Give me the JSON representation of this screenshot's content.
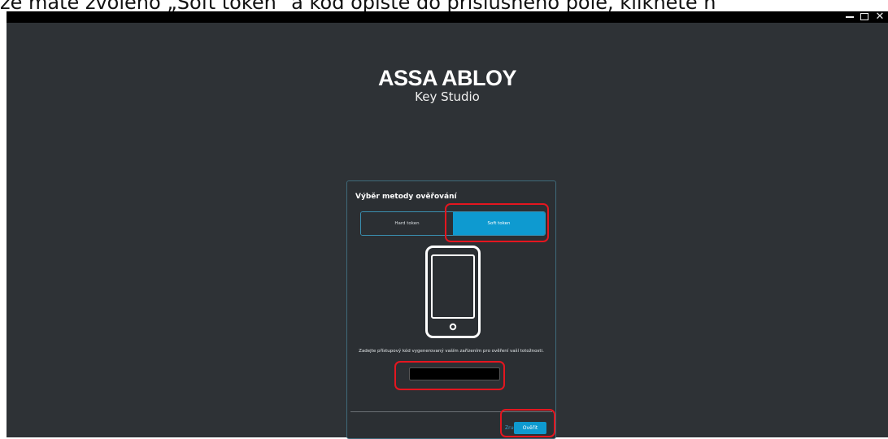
{
  "overlay": {
    "instruction_text": "že máte zvoleno „Soft token“ a kód opište do příslušného pole, klikněte n"
  },
  "window": {
    "controls": {
      "minimize_icon": "minimize-icon",
      "maximize_icon": "maximize-icon",
      "close_icon": "close-icon",
      "close_glyph": "✕"
    }
  },
  "brand": {
    "logo": "ASSA ABLOY",
    "product": "Key Studio"
  },
  "dialog": {
    "title": "Výběr metody ověřování",
    "tabs": [
      {
        "label": "Hard token",
        "selected": false
      },
      {
        "label": "Soft token",
        "selected": true
      }
    ],
    "icon": "smartphone-icon",
    "prompt": "Zadejte přístupový kód vygenerovaný vaším zařízením pro ověření vaší totožnosti.",
    "code_input": {
      "value": "",
      "placeholder": ""
    },
    "cancel_label": "Zrušit",
    "verify_label": "Ověřit"
  },
  "colors": {
    "background": "#2e3236",
    "accent": "#0e9ad0",
    "highlight": "#e4161f",
    "titlebar": "#000000"
  }
}
